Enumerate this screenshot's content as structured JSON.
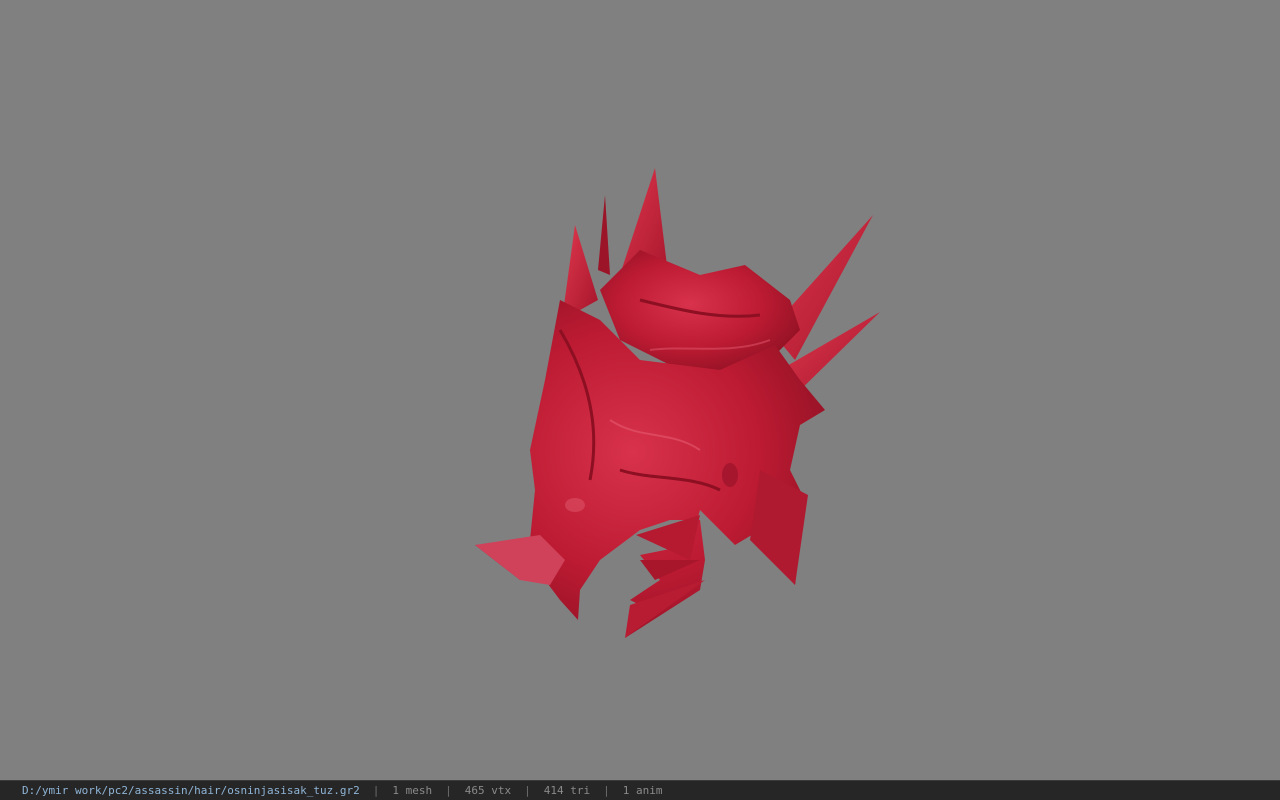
{
  "viewer": {
    "background_color": "#808080",
    "model_color": "#c8203a",
    "model_name": "red spiked helmet"
  },
  "statusbar": {
    "file_path": "D:/ymir work/pc2/assassin/hair/osninjasisak_tuz.gr2",
    "separator": "|",
    "mesh_count": "1 mesh",
    "vertex_count": "465 vtx",
    "triangle_count": "414 tri",
    "anim_count": "1 anim"
  }
}
